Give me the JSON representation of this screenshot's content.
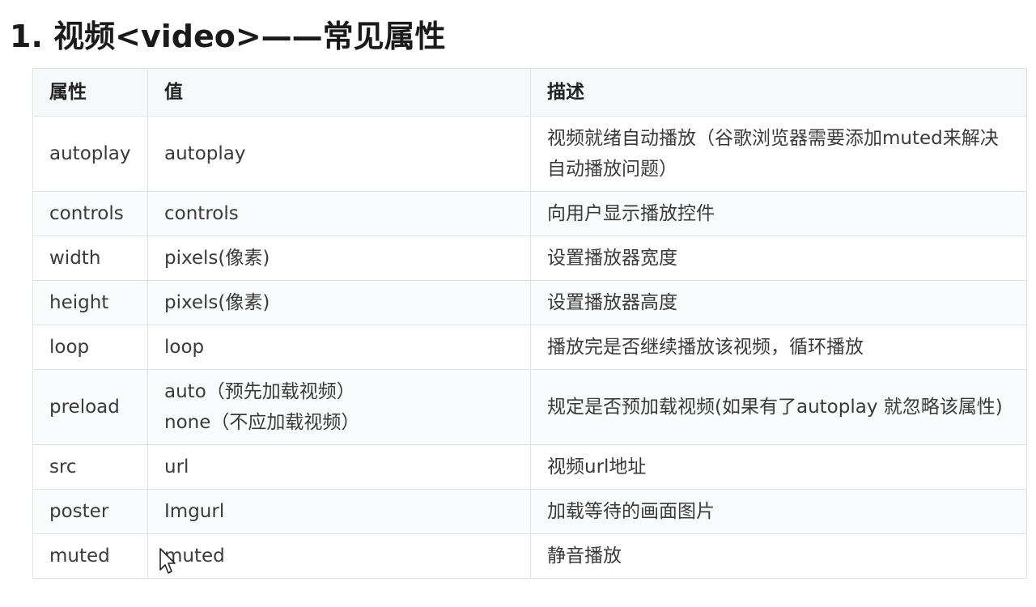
{
  "page": {
    "title": "1. 视频<video>——常见属性"
  },
  "table": {
    "headers": [
      "属性",
      "值",
      "描述"
    ],
    "rows": [
      {
        "attr": "autoplay",
        "value": [
          "autoplay"
        ],
        "desc": "视频就绪自动播放（谷歌浏览器需要添加muted来解决自动播放问题）"
      },
      {
        "attr": "controls",
        "value": [
          "controls"
        ],
        "desc": "向用户显示播放控件"
      },
      {
        "attr": "width",
        "value": [
          "pixels(像素)"
        ],
        "desc": "设置播放器宽度"
      },
      {
        "attr": "height",
        "value": [
          "pixels(像素)"
        ],
        "desc": "设置播放器高度"
      },
      {
        "attr": "loop",
        "value": [
          "loop"
        ],
        "desc": "播放完是否继续播放该视频，循环播放"
      },
      {
        "attr": "preload",
        "value": [
          "auto（预先加载视频）",
          "none（不应加载视频）"
        ],
        "desc": "规定是否预加载视频(如果有了autoplay  就忽略该属性)"
      },
      {
        "attr": "src",
        "value": [
          "url"
        ],
        "desc": "视频url地址"
      },
      {
        "attr": "poster",
        "value": [
          "Imgurl"
        ],
        "desc": "加载等待的画面图片"
      },
      {
        "attr": "muted",
        "value": [
          "muted"
        ],
        "desc": "静音播放"
      }
    ]
  },
  "icons": {
    "cursor": "mouse-pointer-icon"
  }
}
